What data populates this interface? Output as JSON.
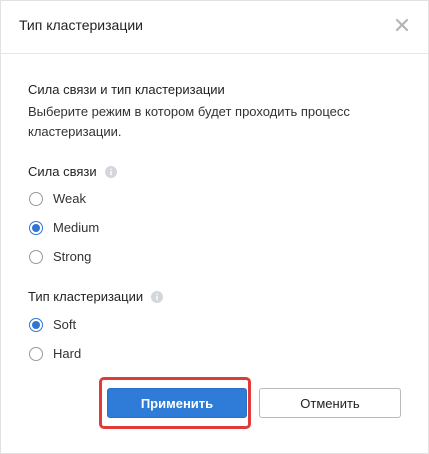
{
  "dialog": {
    "title": "Тип кластеризации"
  },
  "section": {
    "title": "Сила связи и тип кластеризации",
    "description": "Выберите режим в котором будет проходить процесс кластеризации."
  },
  "strength": {
    "label": "Сила связи",
    "options": [
      {
        "label": "Weak",
        "checked": false
      },
      {
        "label": "Medium",
        "checked": true
      },
      {
        "label": "Strong",
        "checked": false
      }
    ]
  },
  "clustering_type": {
    "label": "Тип кластеризации",
    "options": [
      {
        "label": "Soft",
        "checked": true
      },
      {
        "label": "Hard",
        "checked": false
      }
    ]
  },
  "buttons": {
    "apply": "Применить",
    "cancel": "Отменить"
  },
  "colors": {
    "accent": "#2f7bd8",
    "highlight": "#e03b3b"
  },
  "icons": {
    "close": "close-icon",
    "info": "info-icon"
  }
}
